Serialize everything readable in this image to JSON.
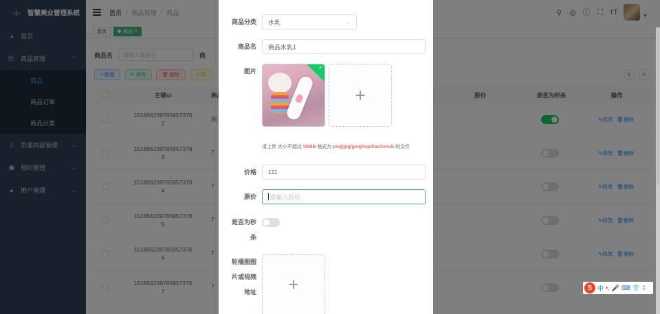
{
  "app": {
    "title": "智慧美业管理系统"
  },
  "sidebar": {
    "items": [
      {
        "label": "首页",
        "icon": "dashboard-icon"
      },
      {
        "label": "商品管理",
        "icon": "cart-icon",
        "expanded": true,
        "children": [
          {
            "label": "商品",
            "active": true
          },
          {
            "label": "商品订单"
          },
          {
            "label": "商品分类"
          }
        ]
      },
      {
        "label": "页面内容管理",
        "icon": "document-icon"
      },
      {
        "label": "预约管理",
        "icon": "calendar-icon"
      },
      {
        "label": "用户管理",
        "icon": "user-icon"
      }
    ]
  },
  "navbar": {
    "breadcrumb": [
      "首页",
      "商品管理",
      "商品"
    ]
  },
  "tags": [
    {
      "label": "首页"
    },
    {
      "label": "商品",
      "active": true
    }
  ],
  "search": {
    "label": "商品名",
    "placeholder": "请输入商品名",
    "label2": "商"
  },
  "toolbar": {
    "add": "+ 新增",
    "edit": "✎ 修改",
    "delete": "🗑 删除",
    "export": "⇓ 导"
  },
  "table": {
    "headers": {
      "id": "主键id",
      "name": "商品名",
      "original_price": "原价",
      "flash": "是否为秒杀",
      "ops": "操作"
    },
    "rows": [
      {
        "id_line1": "151856239785957376",
        "id_line2": "2",
        "name": "商",
        "flash": true
      },
      {
        "id_line1": "151856239785957376",
        "id_line2": "3",
        "name": "7",
        "flash": false
      },
      {
        "id_line1": "151856239785957376",
        "id_line2": "4",
        "name": "7",
        "flash": false
      },
      {
        "id_line1": "151856239785957376",
        "id_line2": "5",
        "name": "7",
        "flash": false
      },
      {
        "id_line1": "151856239785957376",
        "id_line2": "6",
        "name": "7",
        "flash": false
      },
      {
        "id_line1": "151856239785957376",
        "id_line2": "7",
        "name": "7",
        "flash": false
      }
    ],
    "op_edit": "✎修改",
    "op_delete": "🗑删除"
  },
  "dialog": {
    "category": {
      "label": "商品分类",
      "value": "水乳"
    },
    "name": {
      "label": "商品名",
      "value": "商品水乳1"
    },
    "image": {
      "label": "图片"
    },
    "tip": {
      "prefix": "请上传 大小不超过 ",
      "size": "50MB",
      "mid": " 格式为 ",
      "formats": "png/jpg/jpeg/mp4/avi/rmvb",
      "suffix": " 的文件"
    },
    "price": {
      "label": "价格",
      "value": "111"
    },
    "original_price": {
      "label": "原价",
      "placeholder": "请输入原价"
    },
    "flash": {
      "label_line1": "是否为秒",
      "label_line2": "杀",
      "value": false
    },
    "carousel": {
      "label_line1": "轮播图图",
      "label_line2": "片或视频",
      "label_line3": "地址"
    }
  },
  "ime": {
    "label": "中"
  },
  "colors": {
    "sidebar_bg": "#304156",
    "primary": "#409eff",
    "success": "#13ce66",
    "danger": "#f56c6c"
  }
}
